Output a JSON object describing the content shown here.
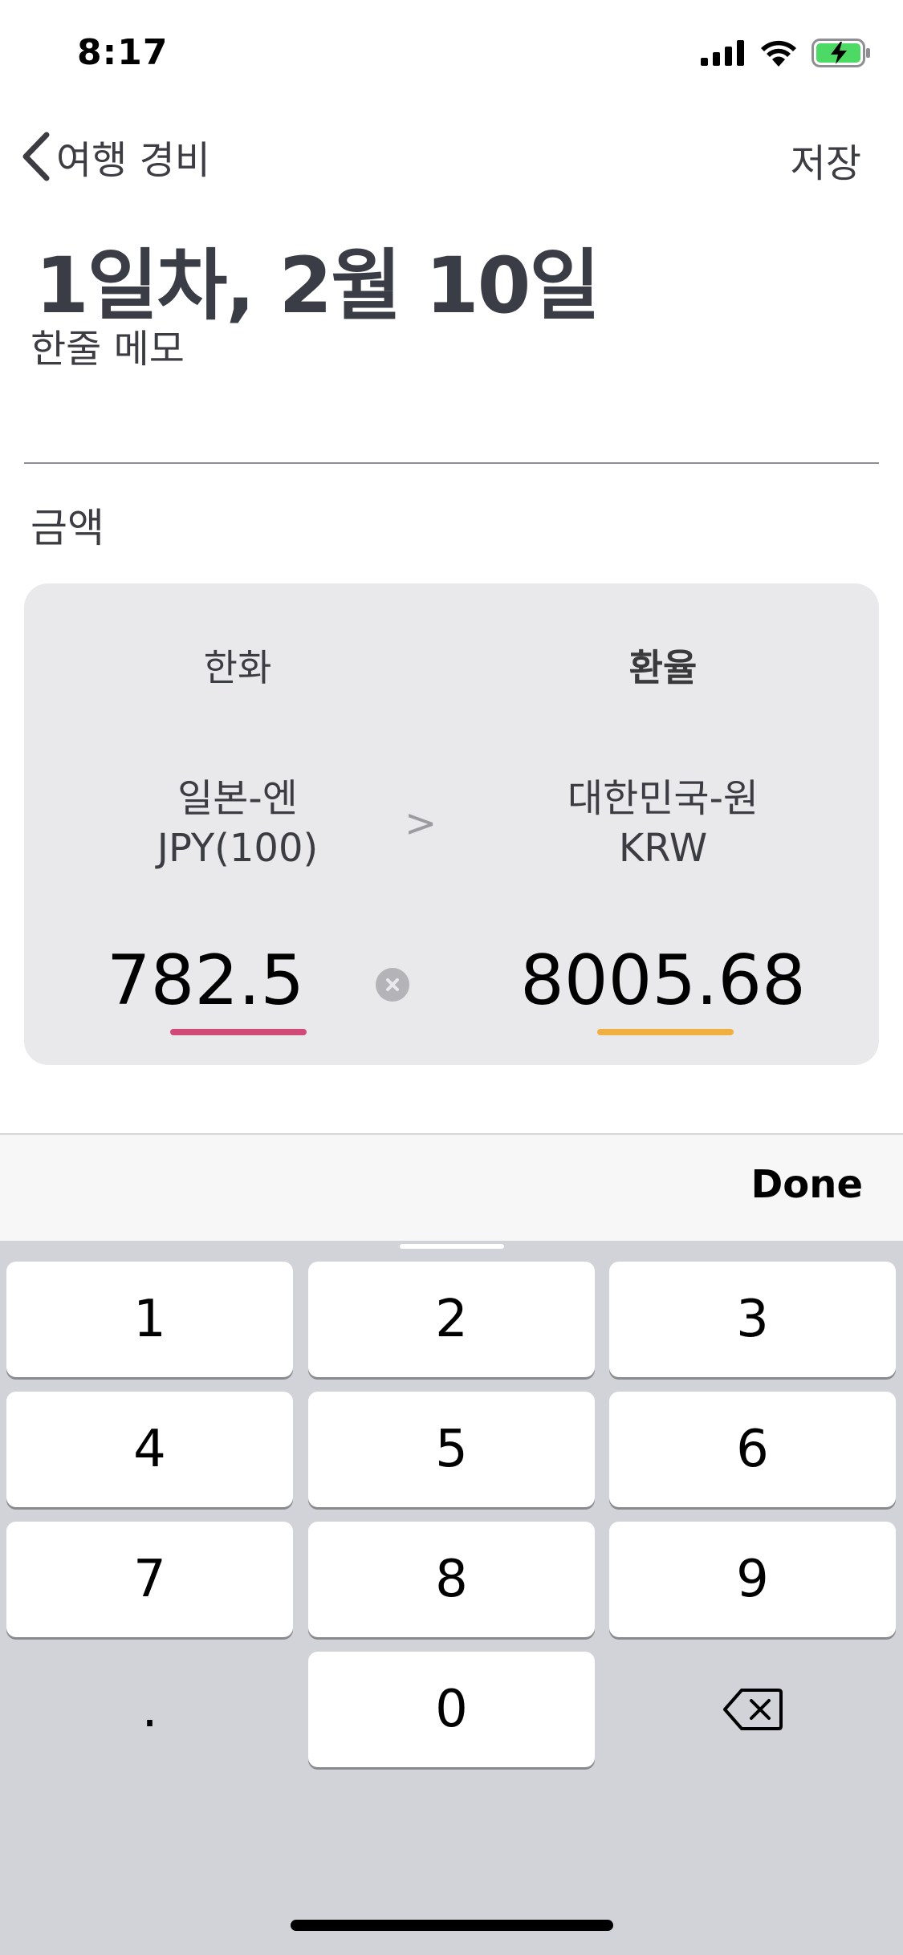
{
  "status_bar": {
    "time": "8:17",
    "signal_icon": "cellular-signal-icon",
    "wifi_icon": "wifi-icon",
    "battery_icon": "battery-charging-icon",
    "battery_color": "#4cd964"
  },
  "nav": {
    "back_label": "여행 경비",
    "save_label": "저장"
  },
  "page": {
    "title": "1일차, 2월 10일",
    "memo_placeholder": "한줄 메모",
    "amount_section_label": "금액"
  },
  "converter": {
    "left_header": "한화",
    "right_header": "환율",
    "from_currency_name": "일본-엔",
    "from_currency_code": "JPY(100)",
    "to_currency_name": "대한민국-원",
    "to_currency_code": "KRW",
    "arrow": ">",
    "from_amount": "782.5",
    "to_amount": "8005.68",
    "from_underline_color": "#d14a77",
    "to_underline_color": "#efb03f"
  },
  "keyboard": {
    "done_label": "Done",
    "keys": [
      "1",
      "2",
      "3",
      "4",
      "5",
      "6",
      "7",
      "8",
      "9",
      ".",
      "0"
    ],
    "delete_icon": "backspace-icon"
  }
}
